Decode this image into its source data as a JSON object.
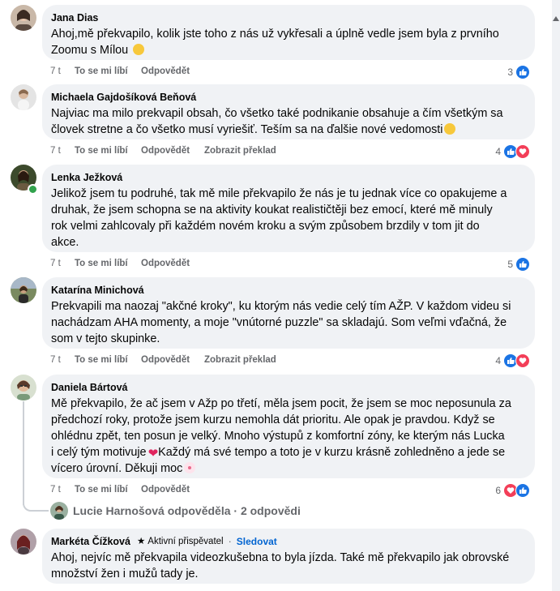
{
  "comments": [
    {
      "author": "Jana Dias",
      "lines": [
        "Ahoj,mě překvapilo, kolik jste toho z nás už vykřesali a úplně vedle jsem byla z prvního",
        "Zoomu s Mílou"
      ],
      "emoji_end": "smile",
      "time": "7 t",
      "like_label": "To se mi líbí",
      "reply_label": "Odpovědět",
      "translate_label": "",
      "reaction_count": "3",
      "reactions": [
        "like"
      ]
    },
    {
      "author": "Michaela Gajdošíková Beňová",
      "lines": [
        "Najviac ma milo prekvapil obsah, čo všetko také podnikanie obsahuje a čím všetkým sa",
        "človek stretne a čo všetko musí vyriešiť. Teším sa na ďalšie nové vedomosti"
      ],
      "emoji_end": "smile",
      "time": "7 t",
      "like_label": "To se mi líbí",
      "reply_label": "Odpovědět",
      "translate_label": "Zobrazit překlad",
      "reaction_count": "4",
      "reactions": [
        "like",
        "love"
      ]
    },
    {
      "author": "Lenka Ježková",
      "lines": [
        "Jelikož jsem tu podruhé, tak mě mile překvapilo že nás je tu jednak více co opakujeme a",
        "druhak, že jsem schopna se na aktivity koukat realističtěji bez emocí, které mě minuly",
        "rok velmi zahlcovaly při každém novém kroku a svým způsobem brzdily v tom jit do",
        "akce."
      ],
      "emoji_end": "",
      "time": "7 t",
      "like_label": "To se mi líbí",
      "reply_label": "Odpovědět",
      "translate_label": "",
      "reaction_count": "5",
      "reactions": [
        "like"
      ]
    },
    {
      "author": "Katarína Minichová",
      "lines": [
        "Prekvapili ma naozaj \"akčné kroky\", ku ktorým nás vedie celý tím AŽP. V každom videu si",
        "nachádzam AHA momenty, a moje \"vnútorné puzzle\" sa skladajú. Som veľmi vďačná, že",
        "som v tejto skupinke."
      ],
      "emoji_end": "",
      "time": "7 t",
      "like_label": "To se mi líbí",
      "reply_label": "Odpovědět",
      "translate_label": "Zobrazit překlad",
      "reaction_count": "4",
      "reactions": [
        "like",
        "love"
      ]
    },
    {
      "author": "Daniela Bártová",
      "lines": [
        "Mě překvapilo, že ač jsem v Ažp po třetí, měla jsem pocit, že jsem se moc neposunula za",
        "předchozí roky, protože jsem kurzu nemohla dát prioritu. Ale opak je pravdou. Když se",
        "ohlédnu zpět, ten posun je velký. Mnoho výstupů z komfortní zóny, ke kterým nás Lucka",
        "i celý tým motivuje",
        "vícero úrovní. Děkuji moc"
      ],
      "line4_tail": "Každý má své tempo a toto je v kurzu krásně zohledněno a jede se",
      "time": "7 t",
      "like_label": "To se mi líbí",
      "reply_label": "Odpovědět",
      "translate_label": "",
      "reaction_count": "6",
      "reactions": [
        "love",
        "like"
      ]
    },
    {
      "author": "Markéta Čížková",
      "badge": "Aktivní přispěvatel",
      "follow": "Sledovat",
      "separator": "·",
      "lines": [
        "Ahoj, nejvíc mě překvapila videozkušebna to byla jízda. Také mě překvapilo jak obrovské",
        "množství žen i mužů tady je."
      ]
    }
  ],
  "reply_summary": "Lucie Harnošová odpověděla · 2 odpovědi"
}
